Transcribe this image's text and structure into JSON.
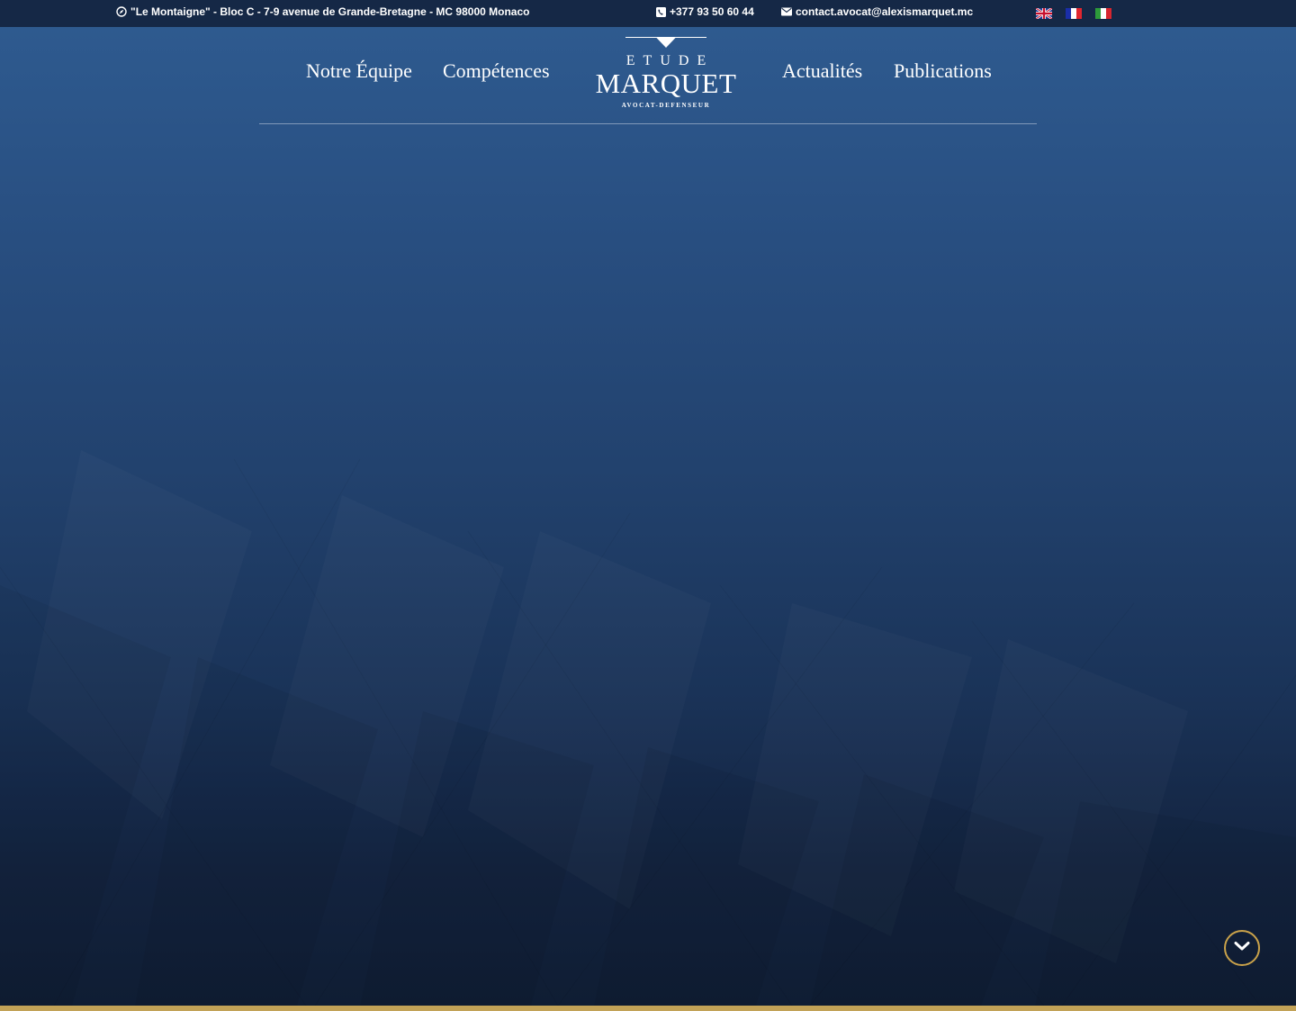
{
  "topbar": {
    "address": "\"Le Montaigne\" - Bloc C - 7-9 avenue de Grande-Bretagne - MC 98000 Monaco",
    "phone": "+377 93 50 60 44",
    "email": "contact.avocat@alexismarquet.mc",
    "icons": {
      "address": "compass-icon",
      "phone": "phone-icon",
      "email": "envelope-icon"
    },
    "languages": [
      {
        "code": "en",
        "flag": "uk-flag-icon"
      },
      {
        "code": "fr",
        "flag": "france-flag-icon"
      },
      {
        "code": "it",
        "flag": "italy-flag-icon"
      }
    ]
  },
  "nav": {
    "items": [
      {
        "label": "Notre Équipe"
      },
      {
        "label": "Compétences"
      },
      {
        "label": "Actualités"
      },
      {
        "label": "Publications"
      }
    ]
  },
  "logo": {
    "line1": "ETUDE",
    "line2": "MARQUET",
    "line3": "AVOCAT-DEFENSEUR"
  },
  "hero": {
    "scroll_icon": "chevron-down-icon"
  },
  "colors": {
    "topbar": "#152846",
    "hero_top": "#2e5a8f",
    "hero_bottom": "#0f1d33",
    "accent_gold": "#c9a24a",
    "strip_gold": "#c2a257"
  }
}
